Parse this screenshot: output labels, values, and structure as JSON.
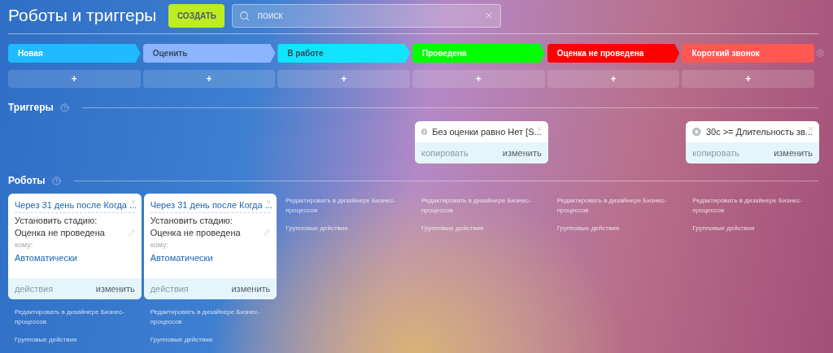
{
  "header": {
    "title": "Роботы и триггеры",
    "create_button": "СОЗДАТЬ",
    "search": {
      "placeholder": "поиск"
    }
  },
  "triggers_title": "Триггеры",
  "robots_title": "Роботы",
  "columns": [
    {
      "stage": {
        "name": "Новая",
        "color": "#1fbaff"
      },
      "add": "+",
      "robots": [
        {
          "title": "Через 31 день после Когда ...",
          "action": "Установить стадию: Оценка не проведена",
          "to_label": "кому:",
          "to_value": "Автоматически",
          "left_action": {
            "label": "действия",
            "disabled": true
          },
          "edit": "изменить"
        }
      ],
      "links": [
        "Редактировать в дизайнере Бизнес-процессов",
        "Групповые действия"
      ]
    },
    {
      "stage": {
        "name": "Оценить",
        "color": "#8cb4ff"
      },
      "add": "+",
      "robots": [
        {
          "title": "Через 31 день после Когда ...",
          "action": "Установить стадию: Оценка не проведена",
          "to_label": "кому:",
          "to_value": "Автоматически",
          "left_action": {
            "label": "действия",
            "disabled": true
          },
          "edit": "изменить"
        }
      ],
      "links": [
        "Редактировать в дизайнере Бизнес-процессов",
        "Групповые действия"
      ]
    },
    {
      "stage": {
        "name": "В работе",
        "color": "#10e5fd"
      },
      "add": "+",
      "links": [
        "Редактировать в дизайнере Бизнес-процессов",
        "Групповые действия"
      ]
    },
    {
      "stage": {
        "name": "Проведена",
        "color": "#00ff00"
      },
      "add": "+",
      "triggers": [
        {
          "text": "Без оценки равно Нет [S...",
          "left_action": {
            "label": "копировать",
            "disabled": true
          },
          "edit": "изменить"
        }
      ],
      "links": [
        "Редактировать в дизайнере Бизнес-процессов",
        "Групповые действия"
      ]
    },
    {
      "stage": {
        "name": "Оценка не проведена",
        "color": "#ff0000"
      },
      "add": "+",
      "links": [
        "Редактировать в дизайнере Бизнес-процессов",
        "Групповые действия"
      ]
    },
    {
      "stage": {
        "name": "Короткий звонок",
        "color": "#ff5752"
      },
      "add": "+",
      "triggers": [
        {
          "text": "30с >= Длительность зв...",
          "left_action": {
            "label": "копировать",
            "disabled": true
          },
          "edit": "изменить"
        }
      ],
      "links": [
        "Редактировать в дизайнере Бизнес-процессов",
        "Групповые действия"
      ]
    }
  ]
}
